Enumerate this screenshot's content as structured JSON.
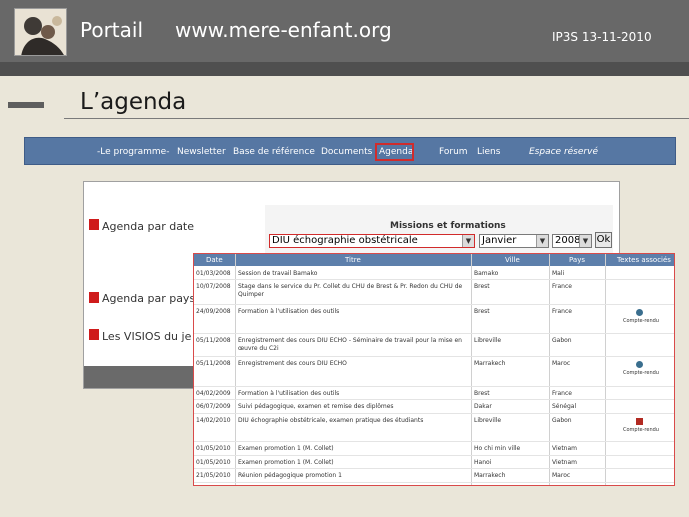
{
  "header": {
    "portal_title": "Portail",
    "site_url": "www.mere-enfant.org",
    "slide_date": "IP3S 13-11-2010"
  },
  "slide_title": "L’agenda",
  "nav": {
    "items": [
      "-Le programme-",
      "Newsletter",
      "Base de référence",
      "Documents",
      "Agenda",
      "Forum",
      "Liens",
      "Espace réservé"
    ],
    "active": "Agenda"
  },
  "left_menu": {
    "items": [
      "Agenda par date",
      "Agenda par pays",
      "Les VISIOS du jeu"
    ]
  },
  "missions": {
    "heading": "Missions et formations",
    "formation_value": "DIU échographie obstétricale",
    "month_value": "Janvier",
    "year_value": "2008",
    "ok_label": "Ok"
  },
  "agenda_table": {
    "headers": [
      "Date",
      "Titre",
      "Ville",
      "Pays",
      "Textes associés"
    ],
    "doc_label": "Compte-rendu",
    "rows": [
      {
        "date": "01/03/2008",
        "title": "Session de travail Bamako",
        "city": "Bamako",
        "country": "Mali",
        "doc": ""
      },
      {
        "date": "10/07/2008",
        "title": "Stage dans le service du Pr. Collet du CHU de Brest & Pr. Redon du CHU de Quimper",
        "city": "Brest",
        "country": "France",
        "doc": ""
      },
      {
        "date": "24/09/2008",
        "title": "Formation à l'utilisation des outils",
        "city": "Brest",
        "country": "France",
        "doc": "globe"
      },
      {
        "date": "05/11/2008",
        "title": "Enregistrement des cours DIU ECHO - Séminaire de travail pour la mise en œuvre du C2i",
        "city": "Libreville",
        "country": "Gabon",
        "doc": ""
      },
      {
        "date": "05/11/2008",
        "title": "Enregistrement des cours DIU ECHO",
        "city": "Marrakech",
        "country": "Maroc",
        "doc": "globe"
      },
      {
        "date": "04/02/2009",
        "title": "Formation à l'utilisation des outils",
        "city": "Brest",
        "country": "France",
        "doc": ""
      },
      {
        "date": "06/07/2009",
        "title": "Suivi pédagogique, examen et remise des diplômes",
        "city": "Dakar",
        "country": "Sénégal",
        "doc": ""
      },
      {
        "date": "14/02/2010",
        "title": "DIU échographie obstétricale, examen pratique des étudiants",
        "city": "Libreville",
        "country": "Gabon",
        "doc": "pdf"
      },
      {
        "date": "01/05/2010",
        "title": "Examen promotion 1 (M. Collet)",
        "city": "Ho chi min ville",
        "country": "Vietnam",
        "doc": ""
      },
      {
        "date": "01/05/2010",
        "title": "Examen promotion 1 (M. Collet)",
        "city": "Hanoi",
        "country": "Vietnam",
        "doc": ""
      },
      {
        "date": "21/05/2010",
        "title": "Réunion pédagogique promotion 1",
        "city": "Marrakech",
        "country": "Maroc",
        "doc": ""
      }
    ]
  },
  "colors": {
    "header_gray": "#686868",
    "nav_blue": "#5677a3",
    "highlight_red": "#d12b2b",
    "table_head_blue": "#5d7fab"
  }
}
